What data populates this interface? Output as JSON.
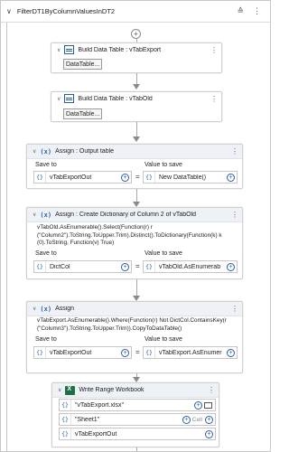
{
  "sequence": {
    "title": "FilterDT1ByColumnValuesInDT2"
  },
  "build1": {
    "title": "Build Data Table : vTabExport",
    "button": "DataTable..."
  },
  "build2": {
    "title": "Build Data Table : vTabOld",
    "button": "DataTable..."
  },
  "assign1": {
    "title": "Assign : Output table",
    "save_to_label": "Save to",
    "value_label": "Value to save",
    "save_to": "vTabExportOut",
    "value": "New DataTable()"
  },
  "assign2": {
    "title": "Assign : Create Dictionary of Column 2 of vTabOld",
    "expression": "vTabOld.AsEnumerable().Select(Function(r) r (\"Column2\").ToString.ToUpper.Trim).Distinct().ToDictionary(Function(k) k (0).ToString, Function(v) True)",
    "save_to_label": "Save to",
    "value_label": "Value to save",
    "save_to": "DictCol",
    "value": "vTabOld.AsEnumerab"
  },
  "assign3": {
    "title": "Assign",
    "expression": "vTabExport.AsEnumerable().Where(Function(r) Not DictCol.ContainsKey(r (\"Column3\").ToString.ToUpper.Trim)).CopyToDataTable()",
    "save_to_label": "Save to",
    "value_label": "Value to save",
    "save_to": "vTabExportOut",
    "value": "vTabExport.AsEnumer"
  },
  "write": {
    "title": "Write Range Workbook",
    "file": "\"vTabExport.xlsx\"",
    "sheet": "\"Sheet1\"",
    "cell_label": "Cell",
    "data": "vTabExportOut"
  },
  "icons": {
    "collapse": "chevron-down-icon",
    "collapse_all": "collapse-all-icon",
    "more": "more-vertical-icon",
    "add": "plus-circle-icon",
    "variable": "curly-braces-icon",
    "folder": "folder-icon",
    "excel": "excel-icon"
  }
}
